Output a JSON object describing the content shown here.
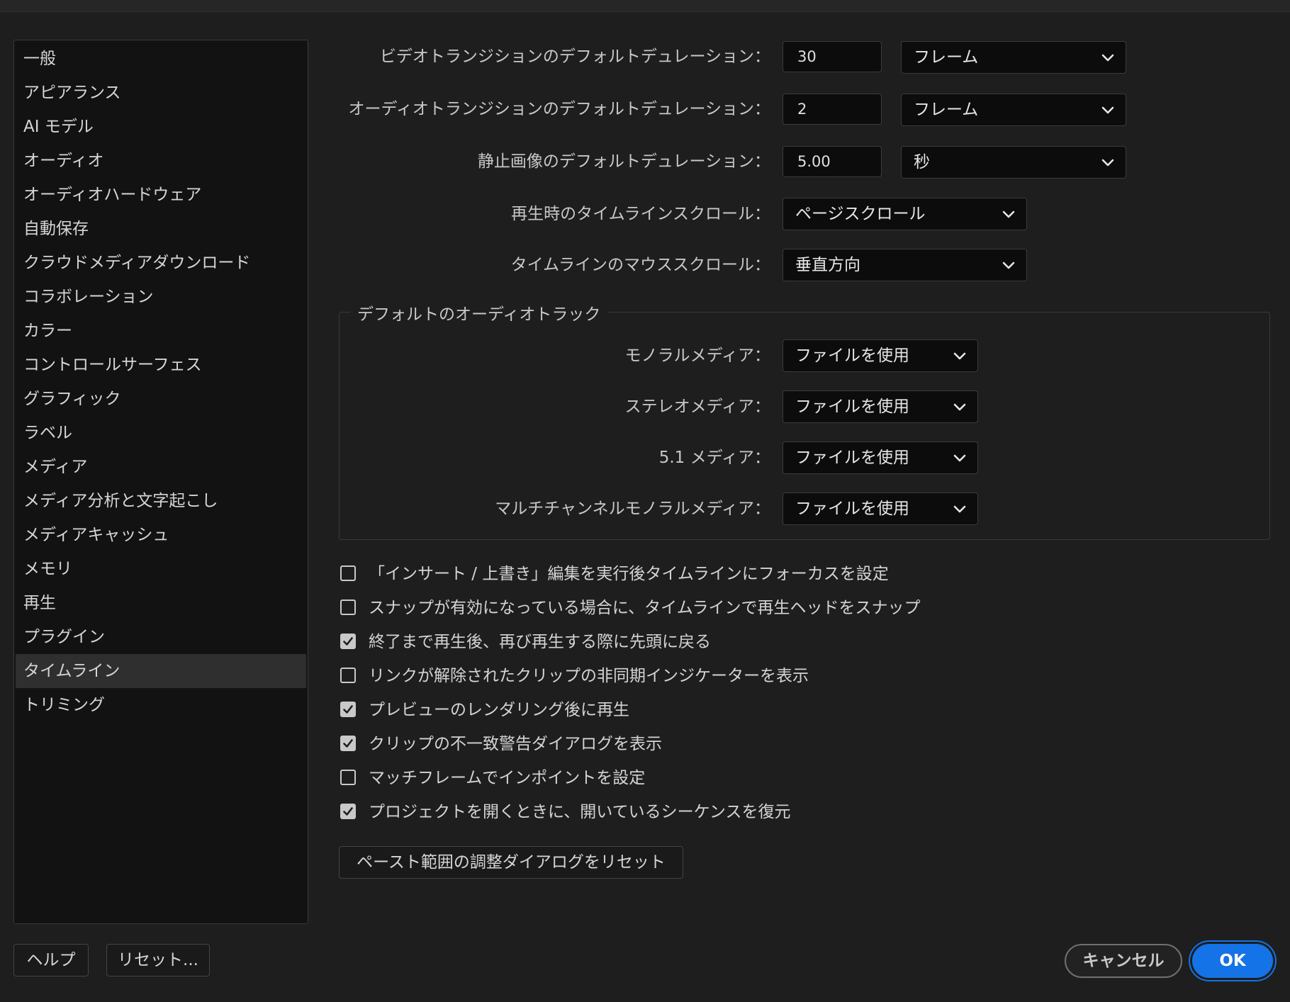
{
  "sidebar": {
    "items": [
      "一般",
      "アピアランス",
      "AI モデル",
      "オーディオ",
      "オーディオハードウェア",
      "自動保存",
      "クラウドメディアダウンロード",
      "コラボレーション",
      "カラー",
      "コントロールサーフェス",
      "グラフィック",
      "ラベル",
      "メディア",
      "メディア分析と文字起こし",
      "メディアキャッシュ",
      "メモリ",
      "再生",
      "プラグイン",
      "タイムライン",
      "トリミング"
    ],
    "selected_index": 18
  },
  "settings": {
    "video_transition": {
      "label": "ビデオトランジションのデフォルトデュレーション：",
      "value": "30",
      "unit": "フレーム"
    },
    "audio_transition": {
      "label": "オーディオトランジションのデフォルトデュレーション：",
      "value": "2",
      "unit": "フレーム"
    },
    "still_image": {
      "label": "静止画像のデフォルトデュレーション：",
      "value": "5.00",
      "unit": "秒"
    },
    "playback_scroll": {
      "label": "再生時のタイムラインスクロール：",
      "value": "ページスクロール"
    },
    "mouse_scroll": {
      "label": "タイムラインのマウススクロール：",
      "value": "垂直方向"
    }
  },
  "audio_tracks": {
    "title": "デフォルトのオーディオトラック",
    "mono": {
      "label": "モノラルメディア：",
      "value": "ファイルを使用"
    },
    "stereo": {
      "label": "ステレオメディア：",
      "value": "ファイルを使用"
    },
    "surround": {
      "label": "5.1 メディア：",
      "value": "ファイルを使用"
    },
    "multichannel": {
      "label": "マルチチャンネルモノラルメディア：",
      "value": "ファイルを使用"
    }
  },
  "checkboxes": [
    {
      "label": "「インサート / 上書き」編集を実行後タイムラインにフォーカスを設定",
      "checked": false
    },
    {
      "label": "スナップが有効になっている場合に、タイムラインで再生ヘッドをスナップ",
      "checked": false
    },
    {
      "label": "終了まで再生後、再び再生する際に先頭に戻る",
      "checked": true
    },
    {
      "label": "リンクが解除されたクリップの非同期インジケーターを表示",
      "checked": false
    },
    {
      "label": "プレビューのレンダリング後に再生",
      "checked": true
    },
    {
      "label": "クリップの不一致警告ダイアログを表示",
      "checked": true
    },
    {
      "label": "マッチフレームでインポイントを設定",
      "checked": false
    },
    {
      "label": "プロジェクトを開くときに、開いているシーケンスを復元",
      "checked": true
    }
  ],
  "buttons": {
    "reset_paste": "ペースト範囲の調整ダイアログをリセット",
    "help": "ヘルプ",
    "reset": "リセット...",
    "cancel": "キャンセル",
    "ok": "OK"
  },
  "colors": {
    "accent": "#1473e6",
    "background": "#1e1e1e",
    "sidebar_bg": "#121212"
  }
}
